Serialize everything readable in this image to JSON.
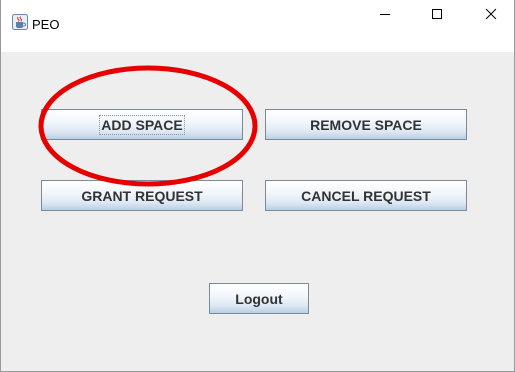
{
  "window": {
    "title": "PEO",
    "icon": "java-cup-icon",
    "controls": {
      "minimize_icon": "minimize-icon",
      "maximize_icon": "maximize-icon",
      "close_icon": "close-icon"
    }
  },
  "buttons": {
    "add_space": "ADD SPACE",
    "remove_space": "REMOVE SPACE",
    "grant_request": "GRANT REQUEST",
    "cancel_request": "CANCEL REQUEST",
    "logout": "Logout"
  },
  "annotation": {
    "shape": "ellipse",
    "color": "#e60000",
    "target": "add-space-button"
  },
  "colors": {
    "window_bg": "#eeeeee",
    "titlebar_bg": "#ffffff",
    "button_border": "#7a8a99",
    "button_text": "#333333"
  }
}
